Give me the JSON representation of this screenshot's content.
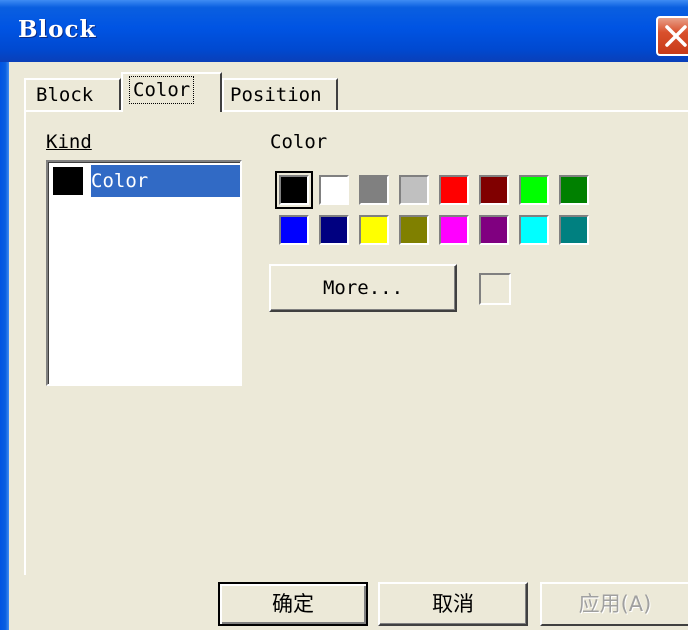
{
  "window": {
    "title": "Block"
  },
  "tabs": [
    {
      "label": "Block",
      "selected": false
    },
    {
      "label": "Color",
      "selected": true
    },
    {
      "label": "Position",
      "selected": false
    }
  ],
  "kind": {
    "label": "Kind",
    "items": [
      {
        "label": "Color",
        "swatch_color": "#000000",
        "selected": true
      }
    ]
  },
  "color": {
    "label": "Color",
    "palette": [
      {
        "name": "black",
        "hex": "#000000",
        "selected": true
      },
      {
        "name": "white",
        "hex": "#ffffff",
        "selected": false
      },
      {
        "name": "gray",
        "hex": "#808080",
        "selected": false
      },
      {
        "name": "silver",
        "hex": "#c0c0c0",
        "selected": false
      },
      {
        "name": "red",
        "hex": "#ff0000",
        "selected": false
      },
      {
        "name": "maroon",
        "hex": "#800000",
        "selected": false
      },
      {
        "name": "lime",
        "hex": "#00ff00",
        "selected": false
      },
      {
        "name": "green",
        "hex": "#008000",
        "selected": false
      },
      {
        "name": "blue",
        "hex": "#0000ff",
        "selected": false
      },
      {
        "name": "navy",
        "hex": "#000080",
        "selected": false
      },
      {
        "name": "yellow",
        "hex": "#ffff00",
        "selected": false
      },
      {
        "name": "olive",
        "hex": "#808000",
        "selected": false
      },
      {
        "name": "magenta",
        "hex": "#ff00ff",
        "selected": false
      },
      {
        "name": "purple",
        "hex": "#800080",
        "selected": false
      },
      {
        "name": "cyan",
        "hex": "#00ffff",
        "selected": false
      },
      {
        "name": "teal",
        "hex": "#008080",
        "selected": false
      }
    ],
    "more_label": "More..."
  },
  "buttons": {
    "ok": "确定",
    "cancel": "取消",
    "apply": "应用(A)",
    "apply_enabled": false
  },
  "theme": {
    "dialog_bg": "#ece9d8",
    "titlebar": "#0054e3",
    "selection": "#316ac5",
    "close_button": "#d9502c"
  }
}
